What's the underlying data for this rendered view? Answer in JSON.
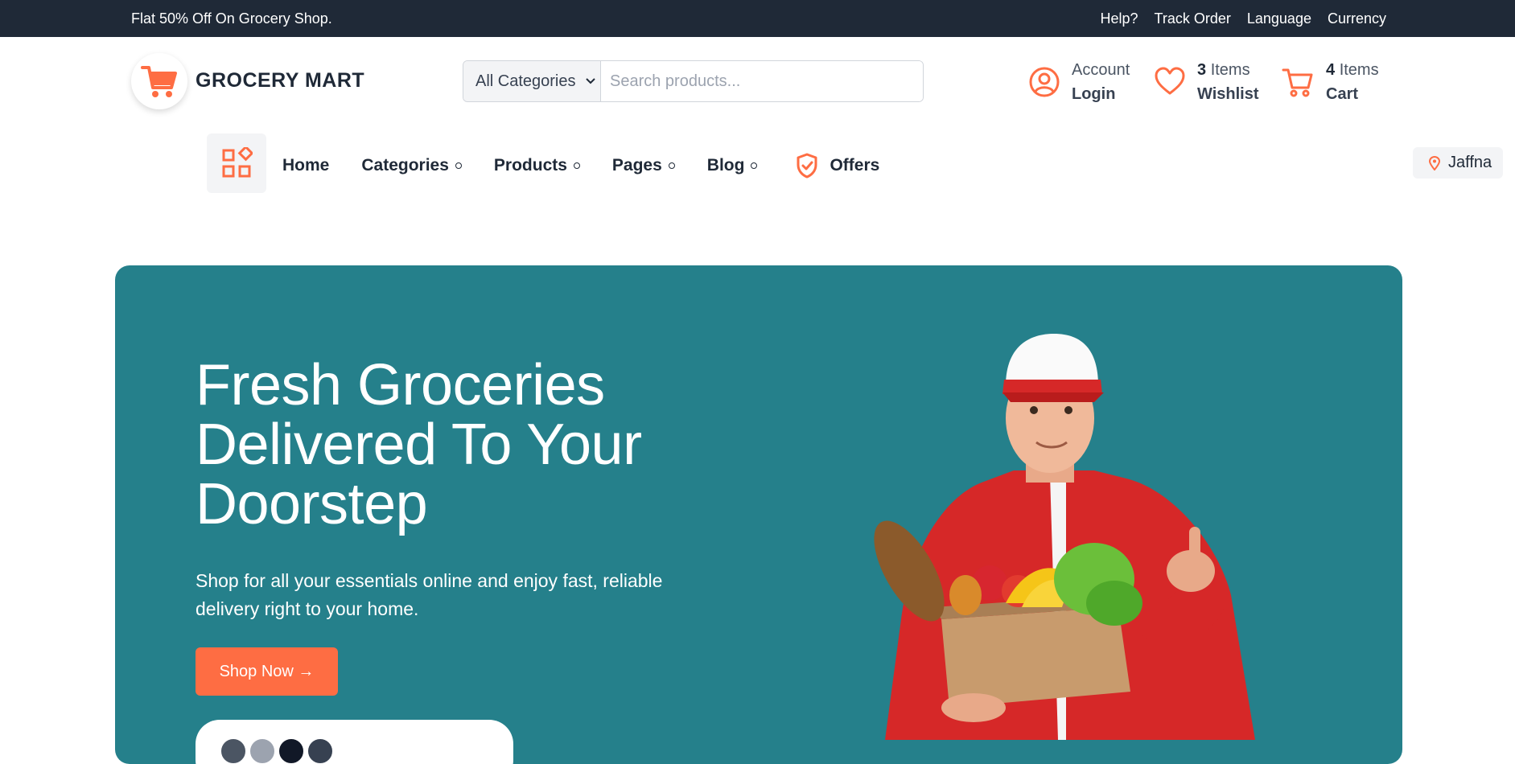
{
  "topbar": {
    "promo": "Flat 50% Off On Grocery Shop.",
    "links": [
      "Help?",
      "Track Order",
      "Language",
      "Currency"
    ]
  },
  "header": {
    "brand": "GROCERY MART",
    "search": {
      "category": "All Categories",
      "placeholder": "Search products..."
    },
    "account": {
      "line1": "Account",
      "line2": "Login"
    },
    "wishlist": {
      "count": "3",
      "label": "Items",
      "line2": "Wishlist"
    },
    "cart": {
      "count": "4",
      "label": "Items",
      "line2": "Cart"
    }
  },
  "nav": {
    "items": [
      {
        "label": "Home",
        "dropdown": false
      },
      {
        "label": "Categories",
        "dropdown": true
      },
      {
        "label": "Products",
        "dropdown": true
      },
      {
        "label": "Pages",
        "dropdown": true
      },
      {
        "label": "Blog",
        "dropdown": true
      }
    ],
    "offers": "Offers",
    "location": "Jaffna"
  },
  "hero": {
    "title": "Fresh Groceries Delivered To Your Doorstep",
    "subtitle": "Shop for all your essentials online and enjoy fast, reliable delivery right to your home.",
    "cta": "Shop Now →"
  },
  "colors": {
    "accent": "#fe6d43",
    "hero_bg": "#25808b",
    "topbar_bg": "#1f2937"
  }
}
